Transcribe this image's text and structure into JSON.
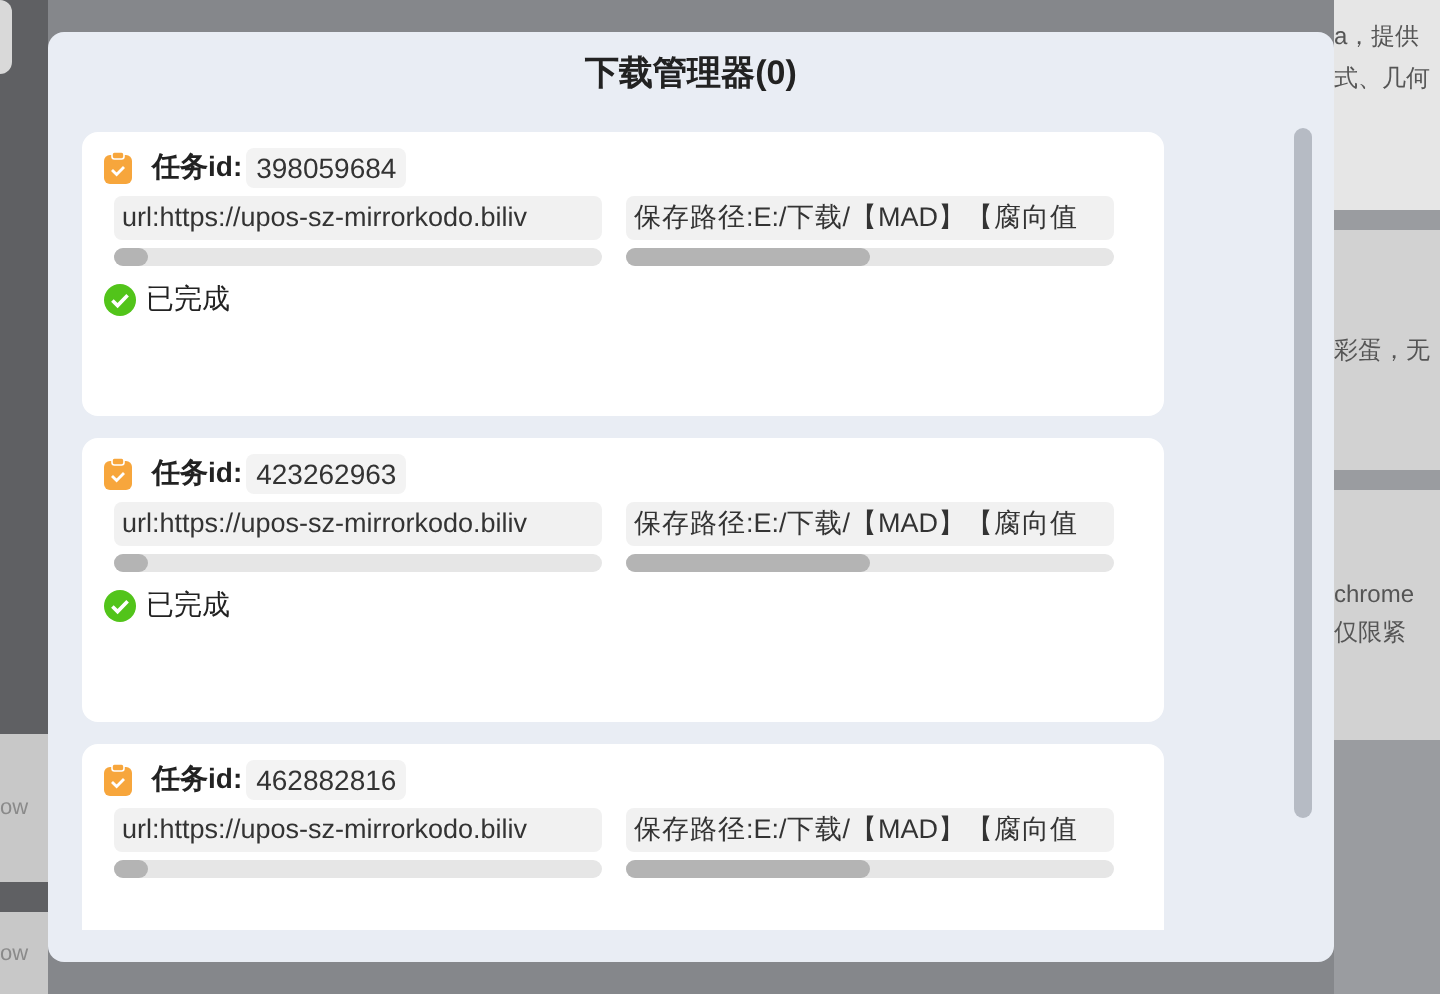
{
  "background": {
    "left_fragments": [
      "ow",
      "ow"
    ],
    "right_fragments": [
      {
        "lines": [
          "a，提供",
          "式、几何"
        ]
      },
      {
        "lines": [
          "彩蛋，无"
        ]
      },
      {
        "lines": [
          "chrome",
          "仅限紧"
        ]
      }
    ]
  },
  "dialog": {
    "title": "下载管理器(0)"
  },
  "tasks": [
    {
      "id_label": "任务id:",
      "id": "398059684",
      "url": {
        "text": "url:https://upos-sz-mirrorkodo.biliv",
        "level": 0.07
      },
      "path": {
        "text": "保存路径:E:/下载/【MAD】【腐向值",
        "level": 0.5
      },
      "status": "已完成",
      "completed": true
    },
    {
      "id_label": "任务id:",
      "id": "423262963",
      "url": {
        "text": "url:https://upos-sz-mirrorkodo.biliv",
        "level": 0.07
      },
      "path": {
        "text": "保存路径:E:/下载/【MAD】【腐向值",
        "level": 0.5
      },
      "status": "已完成",
      "completed": true
    },
    {
      "id_label": "任务id:",
      "id": "462882816",
      "url": {
        "text": "url:https://upos-sz-mirrorkodo.biliv",
        "level": 0.07
      },
      "path": {
        "text": "保存路径:E:/下载/【MAD】【腐向值",
        "level": 0.5
      }
    }
  ]
}
